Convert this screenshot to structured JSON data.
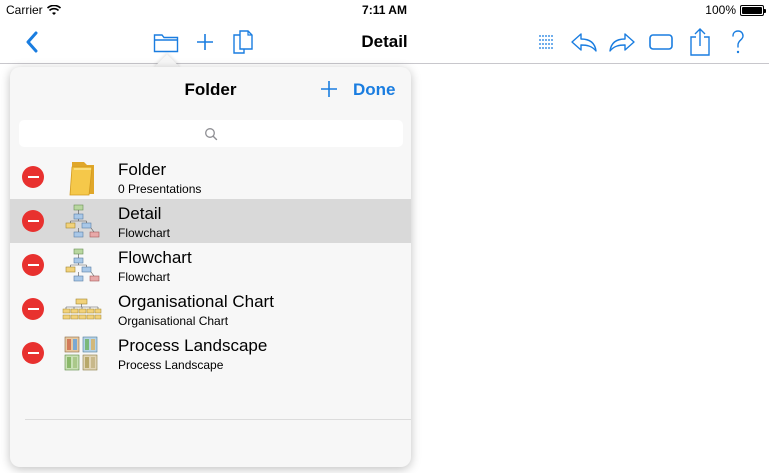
{
  "status_bar": {
    "carrier": "Carrier",
    "time": "7:11 AM",
    "battery": "100%"
  },
  "nav": {
    "title": "Detail",
    "icons": [
      "back-chevron-icon",
      "folder-icon",
      "plus-icon",
      "copy-icon",
      "list-icon",
      "undo-icon",
      "redo-icon",
      "presentation-icon",
      "share-icon",
      "help-icon"
    ]
  },
  "popover": {
    "title": "Folder",
    "done_label": "Done",
    "search_placeholder": "",
    "items": [
      {
        "name": "Folder",
        "subtitle": "0 Presentations",
        "icon": "folder-thumb",
        "selected": false
      },
      {
        "name": "Detail",
        "subtitle": "Flowchart",
        "icon": "flowchart-thumb",
        "selected": true
      },
      {
        "name": "Flowchart",
        "subtitle": "Flowchart",
        "icon": "flowchart-thumb",
        "selected": false
      },
      {
        "name": "Organisational Chart",
        "subtitle": "Organisational Chart",
        "icon": "org-chart-thumb",
        "selected": false
      },
      {
        "name": "Process Landscape",
        "subtitle": "Process Landscape",
        "icon": "process-landscape-thumb",
        "selected": false
      }
    ]
  },
  "colors": {
    "accent": "#1a7de0",
    "delete": "#e8312f",
    "selected_row": "#d9d9d9"
  }
}
